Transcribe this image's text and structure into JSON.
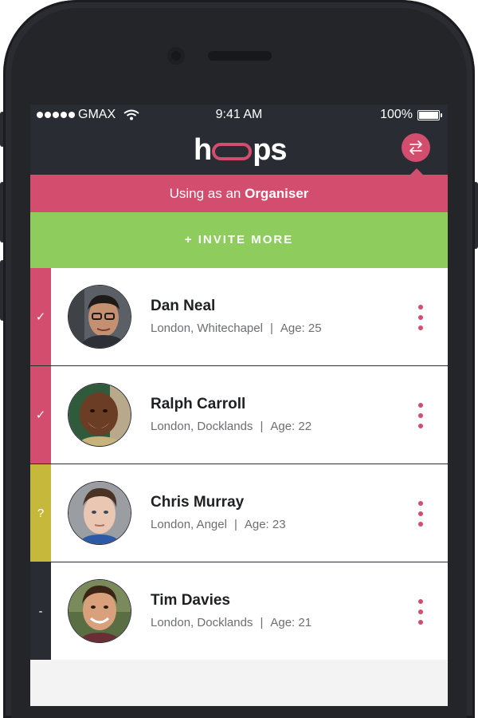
{
  "status_bar": {
    "carrier": "GMAX",
    "time": "9:41 AM",
    "battery": "100%"
  },
  "header": {
    "logo_text_start": "h",
    "logo_text_end": "ps",
    "switch_icon": "swap-arrows-icon"
  },
  "role_banner": {
    "prefix": "Using as an",
    "role": "Organiser"
  },
  "invite_button": {
    "label": "+ INVITE MORE"
  },
  "colors": {
    "accent": "#d34e6e",
    "invite_green": "#8ecc5e",
    "dark": "#2a2c33",
    "maybe": "#c6b83a"
  },
  "participants": [
    {
      "name": "Dan Neal",
      "location": "London, Whitechapel",
      "age": "Age: 25",
      "status": "✓",
      "status_color": "#d34e6e"
    },
    {
      "name": "Ralph Carroll",
      "location": "London, Docklands",
      "age": "Age: 22",
      "status": "✓",
      "status_color": "#d34e6e"
    },
    {
      "name": "Chris Murray",
      "location": "London, Angel",
      "age": "Age: 23",
      "status": "?",
      "status_color": "#c6b83a"
    },
    {
      "name": "Tim Davies",
      "location": "London, Docklands",
      "age": "Age: 21",
      "status": "-",
      "status_color": "#2a2c33"
    }
  ]
}
